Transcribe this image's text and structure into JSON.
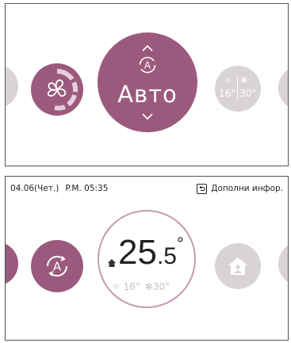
{
  "colors": {
    "accent": "#9b5a7d",
    "inactive": "#d9d4d4",
    "temp_gray": "#c9bfc2"
  },
  "mode_panel": {
    "mode_label": "Авто",
    "mode_icon": "auto-mode-icon",
    "left_icon": "fan-speed-icon",
    "right_card": {
      "heat": "16°",
      "cool": "30°"
    }
  },
  "status_panel": {
    "date": "04.06(Чет.)",
    "time": "P.M. 05:35",
    "info_label": "Дополни инфор.",
    "temperature": {
      "whole": "25",
      "fraction": ".5",
      "degree": "°",
      "heat": "16°",
      "cool": "30°"
    },
    "left_icon": "auto-mode-icon",
    "right_icon": "home-icon"
  }
}
